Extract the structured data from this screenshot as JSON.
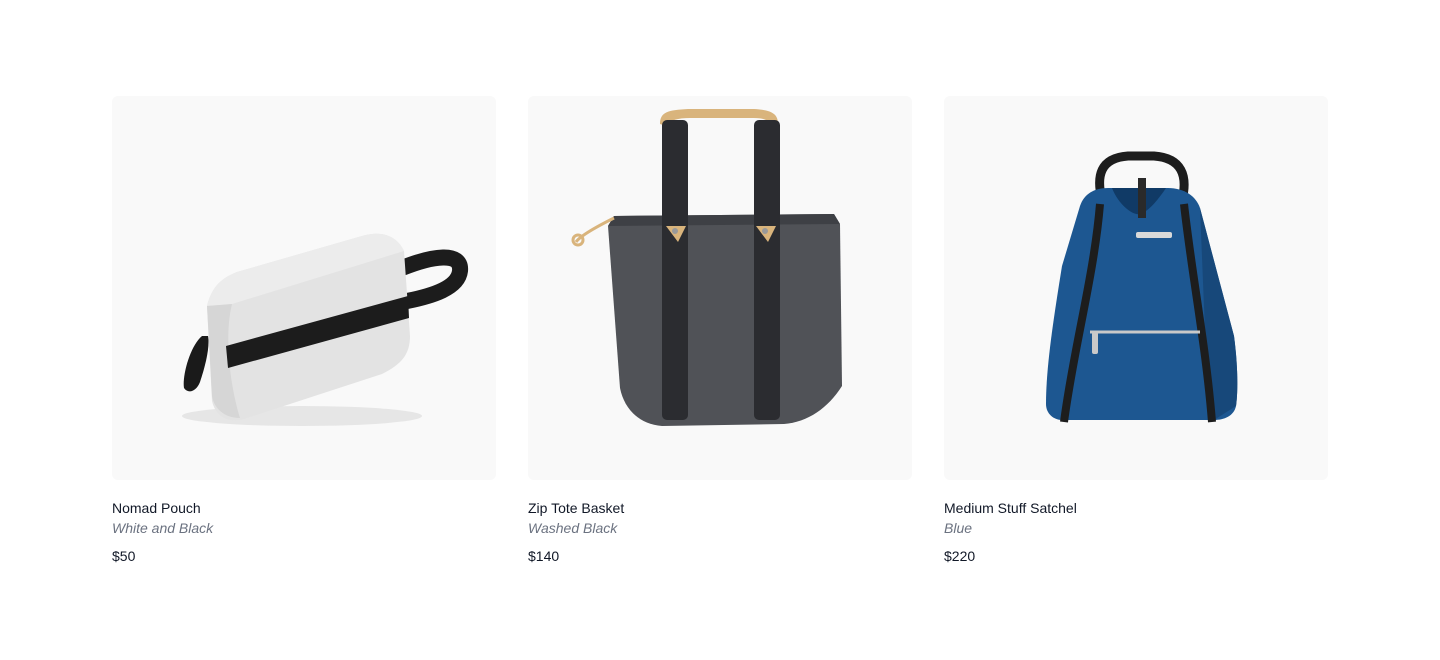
{
  "products": [
    {
      "name": "Nomad Pouch",
      "color": "White and Black",
      "price": "$50",
      "image_icon": "pouch-image"
    },
    {
      "name": "Zip Tote Basket",
      "color": "Washed Black",
      "price": "$140",
      "image_icon": "tote-bag-image"
    },
    {
      "name": "Medium Stuff Satchel",
      "color": "Blue",
      "price": "$220",
      "image_icon": "backpack-image"
    }
  ]
}
